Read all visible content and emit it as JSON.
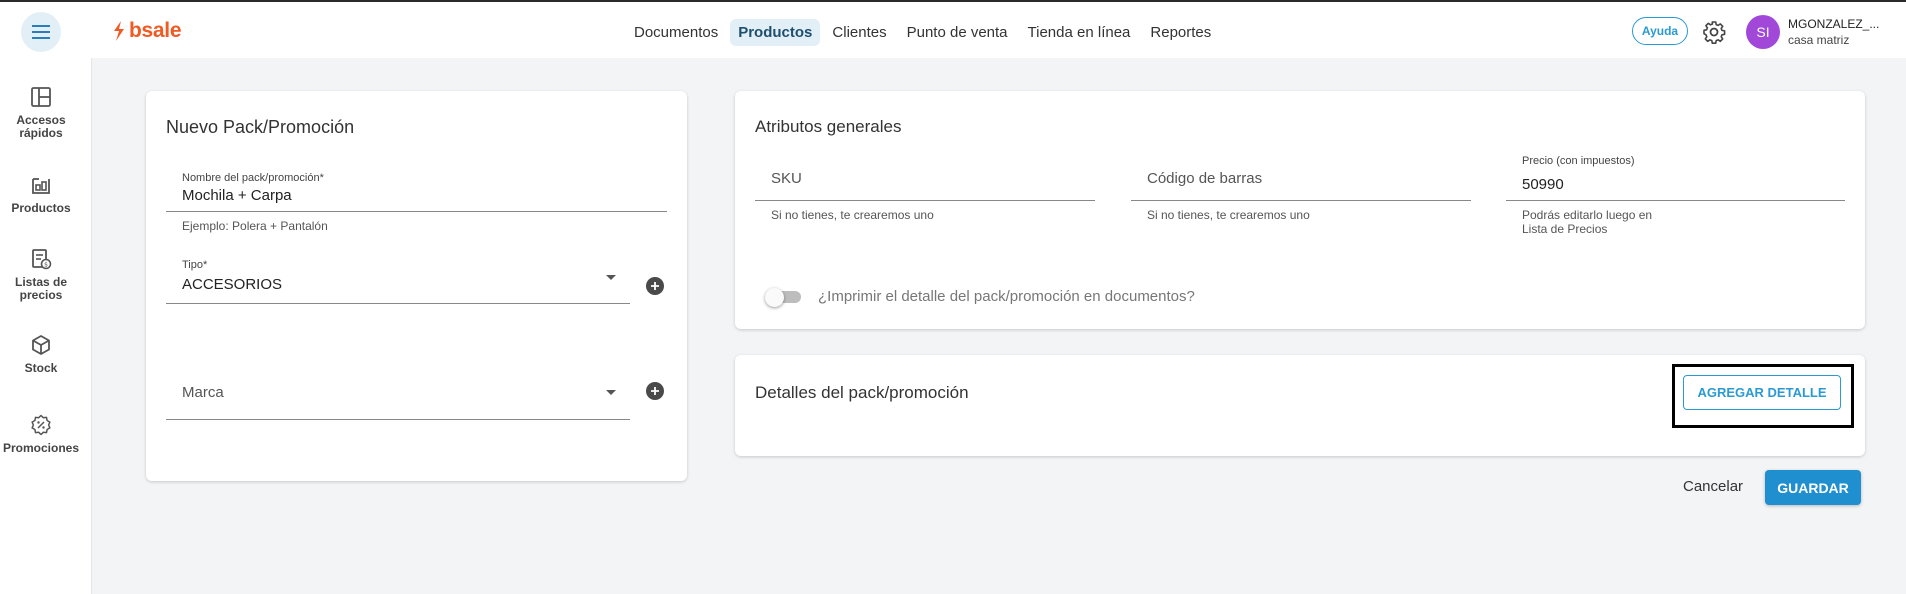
{
  "header": {
    "logo_text": "bsale",
    "nav": [
      {
        "label": "Documentos",
        "active": false
      },
      {
        "label": "Productos",
        "active": true
      },
      {
        "label": "Clientes",
        "active": false
      },
      {
        "label": "Punto de venta",
        "active": false
      },
      {
        "label": "Tienda en línea",
        "active": false
      },
      {
        "label": "Reportes",
        "active": false
      }
    ],
    "help_label": "Ayuda",
    "user": {
      "initials": "SI",
      "name": "MGONZALEZ_...",
      "branch": "casa matriz"
    }
  },
  "sidebar": {
    "items": [
      {
        "label": "Accesos rápidos",
        "icon": "layout-icon"
      },
      {
        "label": "Productos",
        "icon": "products-icon"
      },
      {
        "label": "Listas de precios",
        "icon": "price-list-icon"
      },
      {
        "label": "Stock",
        "icon": "cube-icon"
      },
      {
        "label": "Promociones",
        "icon": "discount-icon"
      }
    ]
  },
  "pack_card": {
    "title": "Nuevo Pack/Promoción",
    "name_field": {
      "label": "Nombre del pack/promoción*",
      "value": "Mochila + Carpa",
      "hint": "Ejemplo: Polera + Pantalón"
    },
    "type_field": {
      "label": "Tipo*",
      "value": "ACCESORIOS"
    },
    "brand_field": {
      "placeholder": "Marca"
    }
  },
  "attributes_card": {
    "title": "Atributos generales",
    "sku": {
      "placeholder": "SKU",
      "hint": "Si no tienes, te crearemos uno"
    },
    "barcode": {
      "placeholder": "Código de barras",
      "hint": "Si no tienes, te crearemos uno"
    },
    "price": {
      "label": "Precio (con impuestos)",
      "value": "50990",
      "hint_line1": "Podrás editarlo luego en",
      "hint_line2": "Lista de Precios"
    },
    "print_toggle": {
      "label": "¿Imprimir el detalle del pack/promoción en documentos?",
      "checked": false
    }
  },
  "details_card": {
    "title": "Detalles del pack/promoción",
    "add_button": "AGREGAR DETALLE"
  },
  "actions": {
    "cancel": "Cancelar",
    "save": "GUARDAR"
  },
  "colors": {
    "brand": "#f05a23",
    "accent": "#2b9ad3",
    "avatar": "#a148d9",
    "background": "#f2f4f6"
  }
}
